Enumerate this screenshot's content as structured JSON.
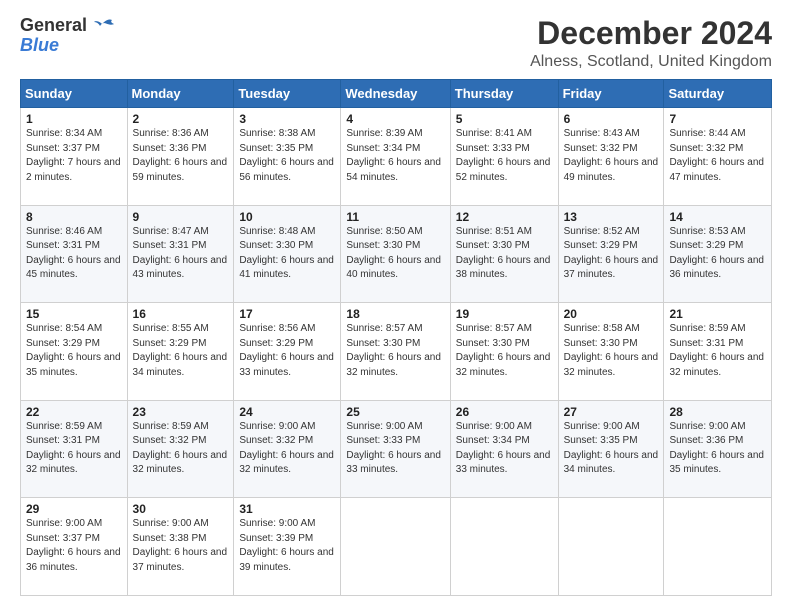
{
  "logo": {
    "line1": "General",
    "line2": "Blue"
  },
  "title": "December 2024",
  "location": "Alness, Scotland, United Kingdom",
  "days_of_week": [
    "Sunday",
    "Monday",
    "Tuesday",
    "Wednesday",
    "Thursday",
    "Friday",
    "Saturday"
  ],
  "weeks": [
    [
      {
        "day": "1",
        "sunrise": "Sunrise: 8:34 AM",
        "sunset": "Sunset: 3:37 PM",
        "daylight": "Daylight: 7 hours and 2 minutes."
      },
      {
        "day": "2",
        "sunrise": "Sunrise: 8:36 AM",
        "sunset": "Sunset: 3:36 PM",
        "daylight": "Daylight: 6 hours and 59 minutes."
      },
      {
        "day": "3",
        "sunrise": "Sunrise: 8:38 AM",
        "sunset": "Sunset: 3:35 PM",
        "daylight": "Daylight: 6 hours and 56 minutes."
      },
      {
        "day": "4",
        "sunrise": "Sunrise: 8:39 AM",
        "sunset": "Sunset: 3:34 PM",
        "daylight": "Daylight: 6 hours and 54 minutes."
      },
      {
        "day": "5",
        "sunrise": "Sunrise: 8:41 AM",
        "sunset": "Sunset: 3:33 PM",
        "daylight": "Daylight: 6 hours and 52 minutes."
      },
      {
        "day": "6",
        "sunrise": "Sunrise: 8:43 AM",
        "sunset": "Sunset: 3:32 PM",
        "daylight": "Daylight: 6 hours and 49 minutes."
      },
      {
        "day": "7",
        "sunrise": "Sunrise: 8:44 AM",
        "sunset": "Sunset: 3:32 PM",
        "daylight": "Daylight: 6 hours and 47 minutes."
      }
    ],
    [
      {
        "day": "8",
        "sunrise": "Sunrise: 8:46 AM",
        "sunset": "Sunset: 3:31 PM",
        "daylight": "Daylight: 6 hours and 45 minutes."
      },
      {
        "day": "9",
        "sunrise": "Sunrise: 8:47 AM",
        "sunset": "Sunset: 3:31 PM",
        "daylight": "Daylight: 6 hours and 43 minutes."
      },
      {
        "day": "10",
        "sunrise": "Sunrise: 8:48 AM",
        "sunset": "Sunset: 3:30 PM",
        "daylight": "Daylight: 6 hours and 41 minutes."
      },
      {
        "day": "11",
        "sunrise": "Sunrise: 8:50 AM",
        "sunset": "Sunset: 3:30 PM",
        "daylight": "Daylight: 6 hours and 40 minutes."
      },
      {
        "day": "12",
        "sunrise": "Sunrise: 8:51 AM",
        "sunset": "Sunset: 3:30 PM",
        "daylight": "Daylight: 6 hours and 38 minutes."
      },
      {
        "day": "13",
        "sunrise": "Sunrise: 8:52 AM",
        "sunset": "Sunset: 3:29 PM",
        "daylight": "Daylight: 6 hours and 37 minutes."
      },
      {
        "day": "14",
        "sunrise": "Sunrise: 8:53 AM",
        "sunset": "Sunset: 3:29 PM",
        "daylight": "Daylight: 6 hours and 36 minutes."
      }
    ],
    [
      {
        "day": "15",
        "sunrise": "Sunrise: 8:54 AM",
        "sunset": "Sunset: 3:29 PM",
        "daylight": "Daylight: 6 hours and 35 minutes."
      },
      {
        "day": "16",
        "sunrise": "Sunrise: 8:55 AM",
        "sunset": "Sunset: 3:29 PM",
        "daylight": "Daylight: 6 hours and 34 minutes."
      },
      {
        "day": "17",
        "sunrise": "Sunrise: 8:56 AM",
        "sunset": "Sunset: 3:29 PM",
        "daylight": "Daylight: 6 hours and 33 minutes."
      },
      {
        "day": "18",
        "sunrise": "Sunrise: 8:57 AM",
        "sunset": "Sunset: 3:30 PM",
        "daylight": "Daylight: 6 hours and 32 minutes."
      },
      {
        "day": "19",
        "sunrise": "Sunrise: 8:57 AM",
        "sunset": "Sunset: 3:30 PM",
        "daylight": "Daylight: 6 hours and 32 minutes."
      },
      {
        "day": "20",
        "sunrise": "Sunrise: 8:58 AM",
        "sunset": "Sunset: 3:30 PM",
        "daylight": "Daylight: 6 hours and 32 minutes."
      },
      {
        "day": "21",
        "sunrise": "Sunrise: 8:59 AM",
        "sunset": "Sunset: 3:31 PM",
        "daylight": "Daylight: 6 hours and 32 minutes."
      }
    ],
    [
      {
        "day": "22",
        "sunrise": "Sunrise: 8:59 AM",
        "sunset": "Sunset: 3:31 PM",
        "daylight": "Daylight: 6 hours and 32 minutes."
      },
      {
        "day": "23",
        "sunrise": "Sunrise: 8:59 AM",
        "sunset": "Sunset: 3:32 PM",
        "daylight": "Daylight: 6 hours and 32 minutes."
      },
      {
        "day": "24",
        "sunrise": "Sunrise: 9:00 AM",
        "sunset": "Sunset: 3:32 PM",
        "daylight": "Daylight: 6 hours and 32 minutes."
      },
      {
        "day": "25",
        "sunrise": "Sunrise: 9:00 AM",
        "sunset": "Sunset: 3:33 PM",
        "daylight": "Daylight: 6 hours and 33 minutes."
      },
      {
        "day": "26",
        "sunrise": "Sunrise: 9:00 AM",
        "sunset": "Sunset: 3:34 PM",
        "daylight": "Daylight: 6 hours and 33 minutes."
      },
      {
        "day": "27",
        "sunrise": "Sunrise: 9:00 AM",
        "sunset": "Sunset: 3:35 PM",
        "daylight": "Daylight: 6 hours and 34 minutes."
      },
      {
        "day": "28",
        "sunrise": "Sunrise: 9:00 AM",
        "sunset": "Sunset: 3:36 PM",
        "daylight": "Daylight: 6 hours and 35 minutes."
      }
    ],
    [
      {
        "day": "29",
        "sunrise": "Sunrise: 9:00 AM",
        "sunset": "Sunset: 3:37 PM",
        "daylight": "Daylight: 6 hours and 36 minutes."
      },
      {
        "day": "30",
        "sunrise": "Sunrise: 9:00 AM",
        "sunset": "Sunset: 3:38 PM",
        "daylight": "Daylight: 6 hours and 37 minutes."
      },
      {
        "day": "31",
        "sunrise": "Sunrise: 9:00 AM",
        "sunset": "Sunset: 3:39 PM",
        "daylight": "Daylight: 6 hours and 39 minutes."
      },
      null,
      null,
      null,
      null
    ]
  ]
}
